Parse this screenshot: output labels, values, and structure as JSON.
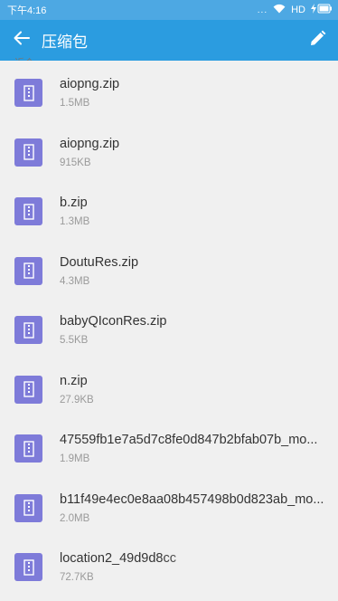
{
  "status_bar": {
    "time": "下午4:16",
    "dots": "...",
    "network": "HD",
    "icons": [
      "wifi-icon",
      "signal-icon",
      "battery-charging-icon"
    ]
  },
  "app_bar": {
    "title": "压缩包",
    "back_icon": "arrow-left-icon",
    "edit_icon": "pencil-icon"
  },
  "section": {
    "peek_label": "近个"
  },
  "files": [
    {
      "name": "aiopng.zip",
      "size": "1.5MB"
    },
    {
      "name": "aiopng.zip",
      "size": "915KB"
    },
    {
      "name": "b.zip",
      "size": "1.3MB"
    },
    {
      "name": "DoutuRes.zip",
      "size": "4.3MB"
    },
    {
      "name": "babyQIconRes.zip",
      "size": "5.5KB"
    },
    {
      "name": "n.zip",
      "size": "27.9KB"
    },
    {
      "name": "47559fb1e7a5d7c8fe0d847b2bfab07b_mo...",
      "size": "1.9MB"
    },
    {
      "name": "b11f49e4ec0e8aa08b457498b0d823ab_mo...",
      "size": "2.0MB"
    },
    {
      "name": "location2_49d9d8cc",
      "size": "72.7KB"
    }
  ],
  "colors": {
    "status_bar": "#4da8e3",
    "app_bar": "#2b9ce0",
    "file_icon": "#7e7bd9",
    "background": "#f0f0f0"
  }
}
